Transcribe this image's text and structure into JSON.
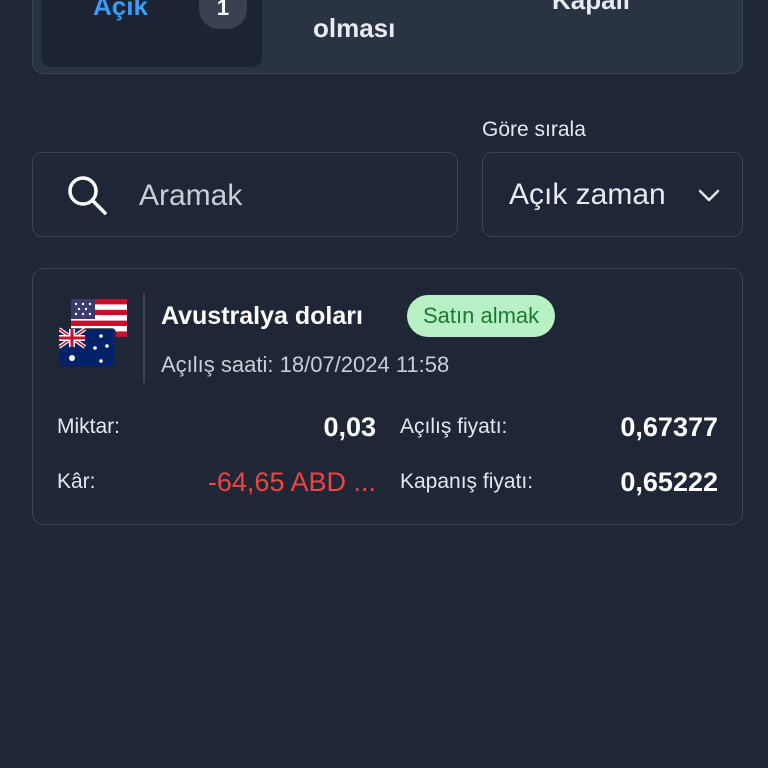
{
  "tabs": {
    "open": {
      "label": "Açık",
      "count": "1"
    },
    "pending": {
      "label": "olması"
    },
    "closed": {
      "label": "Kapalı"
    }
  },
  "sort": {
    "label": "Göre sırala",
    "selected": "Açık zaman"
  },
  "search": {
    "placeholder": "Aramak",
    "value": ""
  },
  "position": {
    "instrument": "Avustralya doları",
    "direction_badge": "Satın almak",
    "open_time_label": "Açılış saati:",
    "open_time_value": "18/07/2024 11:58",
    "amount_label": "Miktar:",
    "amount_value": "0,03",
    "profit_label": "Kâr:",
    "profit_value": "-64,65 ABD ...",
    "open_price_label": "Açılış fiyatı:",
    "open_price_value": "0,67377",
    "close_price_label": "Kapanış fiyatı:",
    "close_price_value": "0,65222",
    "icons": {
      "flags": "usd-aud-flags-icon"
    }
  },
  "colors": {
    "background": "#1f2736",
    "accent_blue": "#3b9bff",
    "buy_badge_bg": "#b9f0c6",
    "buy_badge_text": "#1c7a33",
    "loss_red": "#ef4444"
  }
}
